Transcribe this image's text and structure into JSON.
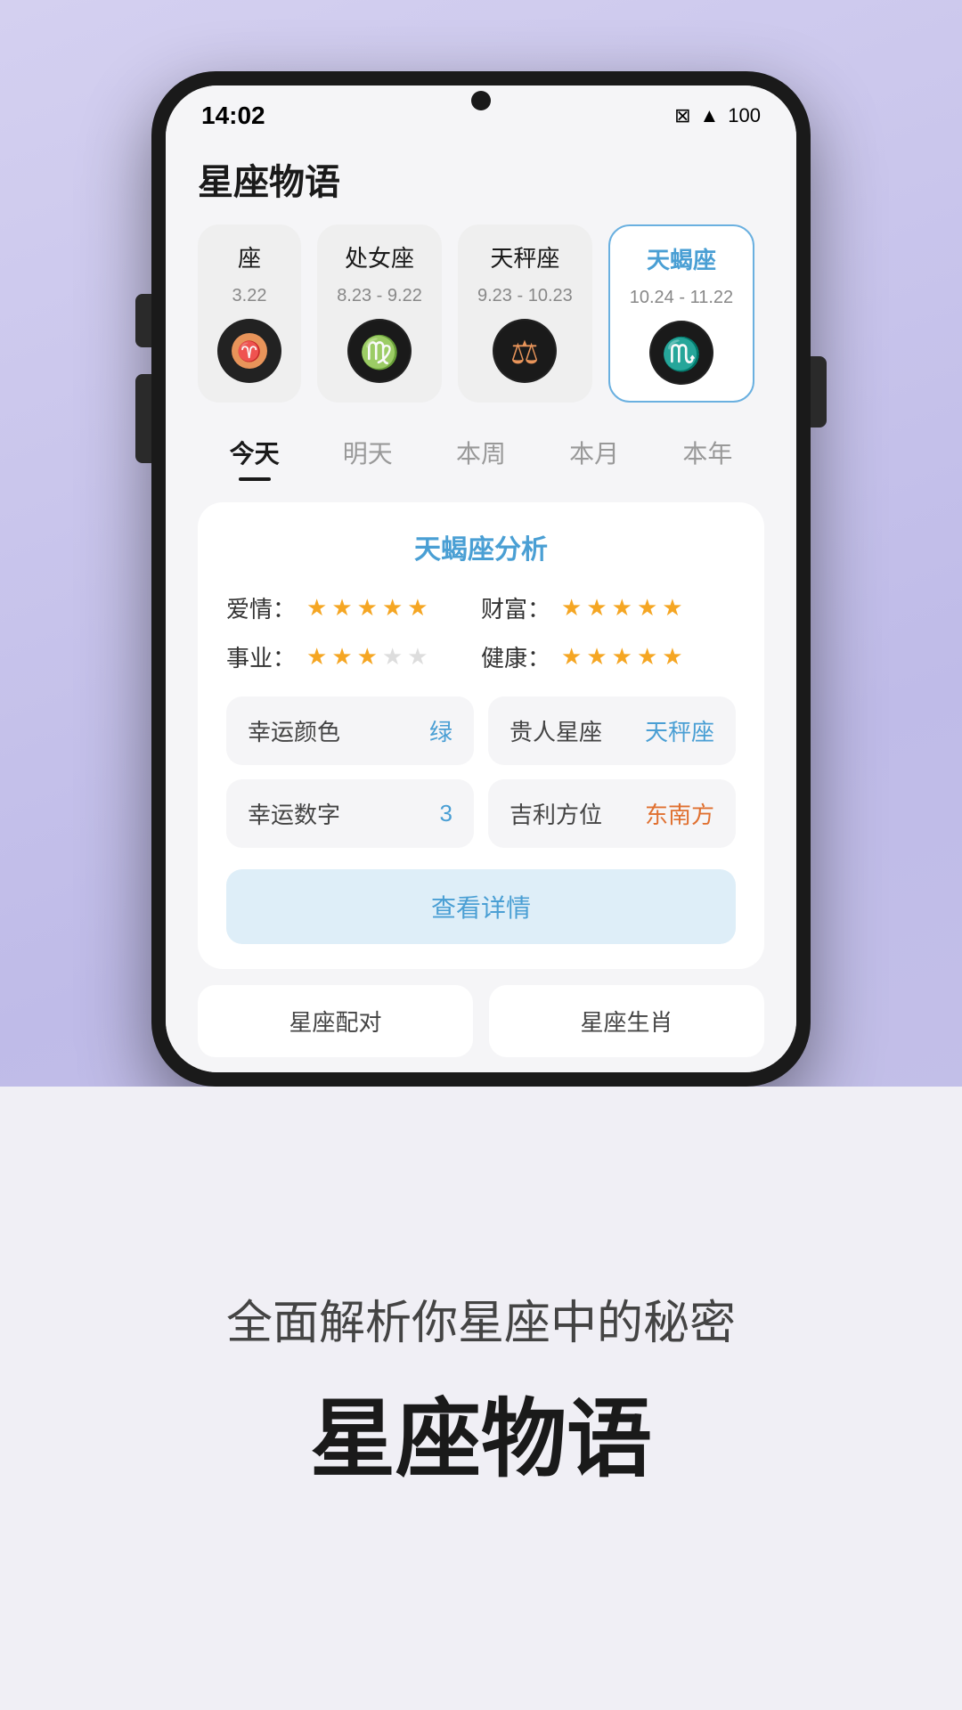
{
  "statusBar": {
    "time": "14:02",
    "icons": "⊠ ▲ 100"
  },
  "app": {
    "title": "星座物语"
  },
  "zodiacCards": [
    {
      "name": "座",
      "date": "3.22",
      "icon": "♈",
      "active": false,
      "partial": true
    },
    {
      "name": "处女座",
      "date": "8.23 - 9.22",
      "icon": "♍",
      "active": false,
      "partial": false
    },
    {
      "name": "天秤座",
      "date": "9.23 - 10.23",
      "icon": "⚖",
      "active": false,
      "partial": false
    },
    {
      "name": "天蝎座",
      "date": "10.24 - 11.22",
      "icon": "♏",
      "active": true,
      "partial": false
    }
  ],
  "timeTabs": [
    {
      "label": "今天",
      "active": true
    },
    {
      "label": "明天",
      "active": false
    },
    {
      "label": "本周",
      "active": false
    },
    {
      "label": "本月",
      "active": false
    },
    {
      "label": "本年",
      "active": false
    }
  ],
  "analysis": {
    "title": "天蝎座分析",
    "ratings": [
      {
        "label": "爱情：",
        "filled": 5,
        "empty": 0,
        "side": "left"
      },
      {
        "label": "财富：",
        "filled": 5,
        "empty": 0,
        "side": "right"
      },
      {
        "label": "事业：",
        "filled": 3,
        "empty": 2,
        "side": "left"
      },
      {
        "label": "健康：",
        "filled": 5,
        "empty": 0,
        "side": "right"
      }
    ],
    "infoBoxes": [
      {
        "label": "幸运颜色",
        "value": "绿",
        "valueColor": "#4a9fd4"
      },
      {
        "label": "贵人星座",
        "value": "天秤座",
        "valueColor": "#4a9fd4"
      },
      {
        "label": "幸运数字",
        "value": "3",
        "valueColor": "#4a9fd4"
      },
      {
        "label": "吉利方位",
        "value": "东南方",
        "valueColor": "#e07030"
      }
    ],
    "detailButton": "查看详情"
  },
  "bottomNav": [
    {
      "label": "星座配对"
    },
    {
      "label": "星座生肖"
    }
  ],
  "bottomSection": {
    "subtitle": "全面解析你星座中的秘密",
    "title": "星座物语"
  }
}
